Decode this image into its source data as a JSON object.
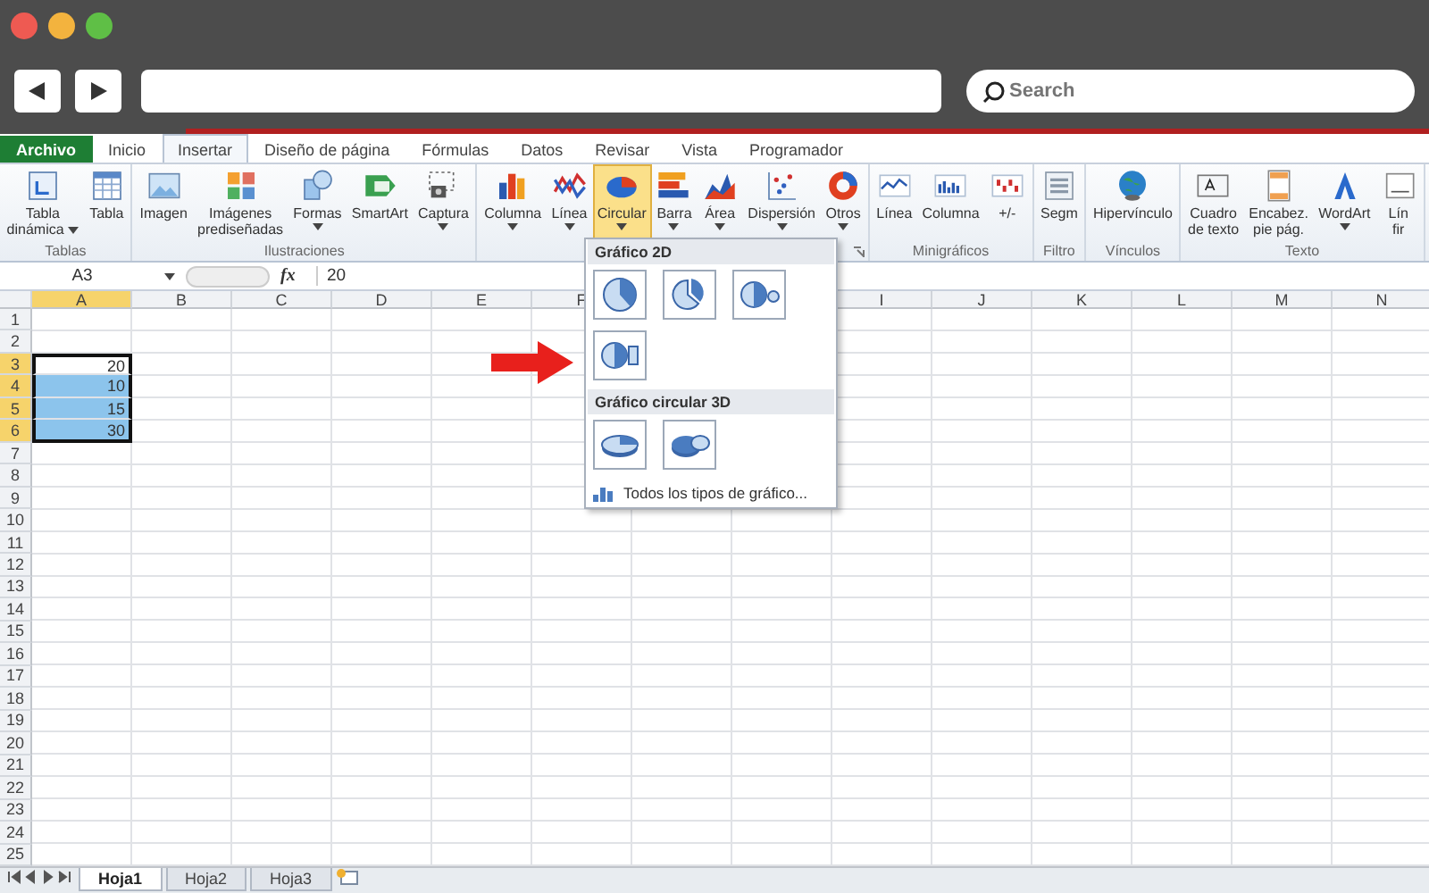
{
  "frame": {
    "search": {
      "placeholder": "Search"
    }
  },
  "tabs": [
    {
      "label": "Archivo",
      "kind": "file",
      "selected": false
    },
    {
      "label": "Inicio",
      "kind": "tab",
      "selected": false
    },
    {
      "label": "Insertar",
      "kind": "tab",
      "selected": true
    },
    {
      "label": "Diseño de página",
      "kind": "tab",
      "selected": false
    },
    {
      "label": "Fórmulas",
      "kind": "tab",
      "selected": false
    },
    {
      "label": "Datos",
      "kind": "tab",
      "selected": false
    },
    {
      "label": "Revisar",
      "kind": "tab",
      "selected": false
    },
    {
      "label": "Vista",
      "kind": "tab",
      "selected": false
    },
    {
      "label": "Programador",
      "kind": "tab",
      "selected": false
    }
  ],
  "groups": [
    {
      "label": "Tablas",
      "launcher": false,
      "buttons": [
        {
          "lines": [
            "Tabla",
            "dinámica"
          ],
          "menu": true,
          "selected": false
        },
        {
          "lines": [
            "Tabla"
          ],
          "menu": false,
          "selected": false
        }
      ]
    },
    {
      "label": "Ilustraciones",
      "launcher": false,
      "buttons": [
        {
          "lines": [
            "Imagen"
          ],
          "menu": false,
          "selected": false
        },
        {
          "lines": [
            "Imágenes",
            "prediseñadas"
          ],
          "menu": false,
          "selected": false
        },
        {
          "lines": [
            "Formas"
          ],
          "menu": true,
          "selected": false
        },
        {
          "lines": [
            "SmartArt"
          ],
          "menu": false,
          "selected": false
        },
        {
          "lines": [
            "Captura"
          ],
          "menu": true,
          "selected": false
        }
      ]
    },
    {
      "launcher": true,
      "buttons": [
        {
          "lines": [
            "Columna"
          ],
          "menu": true,
          "selected": false
        },
        {
          "lines": [
            "Línea"
          ],
          "menu": true,
          "selected": false
        },
        {
          "lines": [
            "Circular"
          ],
          "menu": true,
          "selected": true
        },
        {
          "lines": [
            "Barra"
          ],
          "menu": true,
          "selected": false
        },
        {
          "lines": [
            "Área"
          ],
          "menu": true,
          "selected": false
        },
        {
          "lines": [
            "Dispersión"
          ],
          "menu": true,
          "selected": false
        },
        {
          "lines": [
            "Otros"
          ],
          "menu": true,
          "selected": false
        }
      ]
    },
    {
      "label": "Minigráficos",
      "launcher": false,
      "buttons": [
        {
          "lines": [
            "Línea"
          ],
          "menu": false,
          "selected": false
        },
        {
          "lines": [
            "Columna"
          ],
          "menu": false,
          "selected": false
        },
        {
          "lines": [
            "+/-"
          ],
          "menu": false,
          "selected": false
        }
      ]
    },
    {
      "label": "Filtro",
      "launcher": false,
      "buttons": [
        {
          "lines": [
            "Segm"
          ],
          "menu": false,
          "selected": false
        }
      ]
    },
    {
      "label": "Vínculos",
      "launcher": false,
      "buttons": [
        {
          "lines": [
            "Hipervínculo"
          ],
          "menu": false,
          "selected": false
        }
      ]
    },
    {
      "label": "Texto",
      "launcher": false,
      "buttons": [
        {
          "lines": [
            "Cuadro",
            "de texto"
          ],
          "menu": false,
          "selected": false
        },
        {
          "lines": [
            "Encabez.",
            "pie pág."
          ],
          "menu": false,
          "selected": false
        },
        {
          "lines": [
            "WordArt"
          ],
          "menu": true,
          "selected": false
        },
        {
          "lines": [
            "Lín",
            "fir"
          ],
          "menu": false,
          "selected": false
        }
      ]
    }
  ],
  "formula_bar": {
    "name_box": "A3",
    "function_label": "fx",
    "formula": "20"
  },
  "sheet": {
    "columns": [
      {
        "kind": "header",
        "label": "A",
        "selected": true
      },
      {
        "kind": "header",
        "label": "B",
        "selected": false
      },
      {
        "kind": "header",
        "label": "C",
        "selected": false
      },
      {
        "kind": "header",
        "label": "D",
        "selected": false
      },
      {
        "kind": "header",
        "label": "E",
        "selected": false
      },
      {
        "kind": "header",
        "label": "F",
        "selected": false
      },
      {
        "kind": "covered"
      },
      {
        "kind": "covered"
      },
      {
        "kind": "header",
        "label": "I",
        "selected": false
      },
      {
        "kind": "header",
        "label": "J",
        "selected": false
      },
      {
        "kind": "header",
        "label": "K",
        "selected": false
      },
      {
        "kind": "header",
        "label": "L",
        "selected": false
      },
      {
        "kind": "header",
        "label": "M",
        "selected": false
      },
      {
        "kind": "header",
        "label": "N",
        "selected": false
      }
    ],
    "rows": [
      {
        "label": "1",
        "selected": false
      },
      {
        "label": "2",
        "selected": false
      },
      {
        "label": "3",
        "selected": true,
        "cells": [
          {
            "value": "20",
            "active": true
          }
        ]
      },
      {
        "label": "4",
        "selected": true,
        "cells": [
          {
            "value": "10",
            "active": false
          }
        ]
      },
      {
        "label": "5",
        "selected": true,
        "cells": [
          {
            "value": "15",
            "active": false
          }
        ]
      },
      {
        "label": "6",
        "selected": true,
        "cells": [
          {
            "value": "30",
            "active": false
          }
        ]
      },
      {
        "label": "7",
        "selected": false
      },
      {
        "label": "8",
        "selected": false
      },
      {
        "label": "9",
        "selected": false
      },
      {
        "label": "10",
        "selected": false
      },
      {
        "label": "11",
        "selected": false
      },
      {
        "label": "12",
        "selected": false
      },
      {
        "label": "13",
        "selected": false
      },
      {
        "label": "14",
        "selected": false
      },
      {
        "label": "15",
        "selected": false
      },
      {
        "label": "16",
        "selected": false
      },
      {
        "label": "17",
        "selected": false
      },
      {
        "label": "18",
        "selected": false
      },
      {
        "label": "19",
        "selected": false
      },
      {
        "label": "20",
        "selected": false
      },
      {
        "label": "21",
        "selected": false
      },
      {
        "label": "22",
        "selected": false
      },
      {
        "label": "23",
        "selected": false
      },
      {
        "label": "24",
        "selected": false
      },
      {
        "label": "25",
        "selected": false
      }
    ]
  },
  "sheet_tabs": [
    {
      "label": "Hoja1",
      "selected": true
    },
    {
      "label": "Hoja2",
      "selected": false
    },
    {
      "label": "Hoja3",
      "selected": false
    }
  ],
  "dropdown": {
    "sections": [
      {
        "title": "Gráfico 2D",
        "items": [
          {
            "kind": "pie"
          },
          {
            "kind": "exploded"
          },
          {
            "kind": "pie-of-pie"
          },
          {
            "kind": "bar-of-pie"
          }
        ]
      },
      {
        "title": "Gráfico circular 3D",
        "items": [
          {
            "kind": "pie-3d"
          },
          {
            "kind": "exploded-3d"
          }
        ]
      }
    ],
    "footer": "Todos los tipos de gráfico..."
  }
}
